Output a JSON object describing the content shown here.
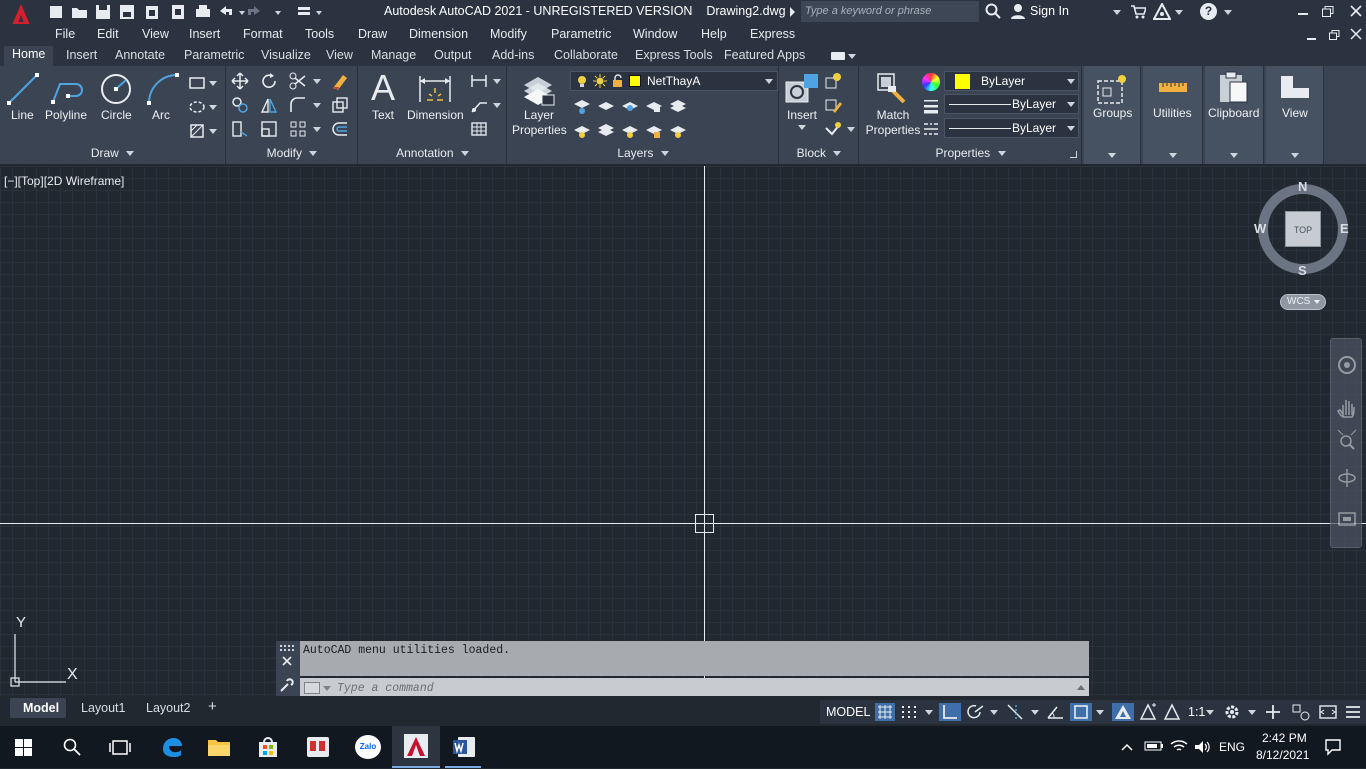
{
  "titlebar": {
    "title": "Autodesk AutoCAD 2021 - UNREGISTERED VERSION    Drawing2.dwg",
    "search_placeholder": "Type a keyword or phrase",
    "sign_in": "Sign In"
  },
  "menubar": [
    "File",
    "Edit",
    "View",
    "Insert",
    "Format",
    "Tools",
    "Draw",
    "Dimension",
    "Modify",
    "Parametric",
    "Window",
    "Help",
    "Express"
  ],
  "ribbon_tabs": [
    "Home",
    "Insert",
    "Annotate",
    "Parametric",
    "Visualize",
    "View",
    "Manage",
    "Output",
    "Add-ins",
    "Collaborate",
    "Express Tools",
    "Featured Apps"
  ],
  "ribbon": {
    "draw": {
      "title": "Draw",
      "line": "Line",
      "polyline": "Polyline",
      "circle": "Circle",
      "arc": "Arc"
    },
    "modify": {
      "title": "Modify"
    },
    "annotation": {
      "title": "Annotation",
      "text": "Text",
      "dimension": "Dimension"
    },
    "layers": {
      "title": "Layers",
      "layer_properties_1": "Layer",
      "layer_properties_2": "Properties",
      "current_layer": "NetThayA",
      "layer_color": "#ffff00"
    },
    "block": {
      "title": "Block",
      "insert": "Insert"
    },
    "properties": {
      "title": "Properties",
      "match_1": "Match",
      "match_2": "Properties",
      "color": "ByLayer",
      "linetype": "ByLayer",
      "lineweight": "ByLayer"
    },
    "groups": "Groups",
    "utilities": "Utilities",
    "clipboard": "Clipboard",
    "view": "View"
  },
  "viewport": {
    "label": "[−][Top][2D Wireframe]",
    "compass": {
      "n": "N",
      "s": "S",
      "e": "E",
      "w": "W",
      "cube": "TOP"
    },
    "wcs": "WCS",
    "ucs_x": "X",
    "ucs_y": "Y"
  },
  "command": {
    "history": "AutoCAD menu utilities loaded.",
    "placeholder": "Type a command"
  },
  "layout_tabs": [
    "Model",
    "Layout1",
    "Layout2"
  ],
  "status": {
    "model": "MODEL",
    "scale": "1:1"
  },
  "taskbar": {
    "time": "2:42 PM",
    "date": "8/12/2021",
    "lang": "ENG",
    "zalo": "Zalo"
  }
}
